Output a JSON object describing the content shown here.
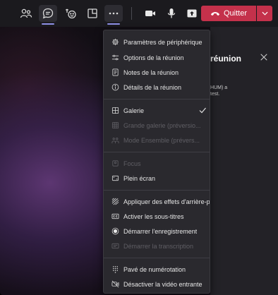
{
  "toolbar": {
    "quit_label": "Quitter",
    "icons": [
      "people-icon",
      "chat-icon",
      "reactions-icon",
      "rooms-icon",
      "more-icon",
      "camera-icon",
      "mic-icon",
      "share-icon",
      "phone-icon",
      "chevron-down-icon"
    ],
    "active": "chat-icon"
  },
  "side_panel": {
    "title": "réunion",
    "text_line1": "HUM) a",
    "text_line2": "test."
  },
  "menu": {
    "items": [
      {
        "label": "Paramètres de périphérique",
        "icon": "gear-icon",
        "disabled": false
      },
      {
        "label": "Options de la réunion",
        "icon": "sliders-icon",
        "disabled": false
      },
      {
        "label": "Notes de la réunion",
        "icon": "notes-icon",
        "disabled": false
      },
      {
        "label": "Détails de la réunion",
        "icon": "info-icon",
        "disabled": false
      },
      {
        "label": "Galerie",
        "icon": "gallery-icon",
        "disabled": false,
        "checked": true
      },
      {
        "label": "Grande galerie (préversio...",
        "icon": "large-gallery-icon",
        "disabled": true
      },
      {
        "label": "Mode Ensemble (prévers...",
        "icon": "together-mode-icon",
        "disabled": true
      },
      {
        "label": "Focus",
        "icon": "focus-icon",
        "disabled": true
      },
      {
        "label": "Plein écran",
        "icon": "fullscreen-icon",
        "disabled": false
      },
      {
        "label": "Appliquer des effets d'arrière-p",
        "icon": "background-effects-icon",
        "disabled": false
      },
      {
        "label": "Activer les sous-titres",
        "icon": "captions-icon",
        "disabled": false
      },
      {
        "label": "Démarrer l'enregistrement",
        "icon": "record-icon",
        "disabled": false
      },
      {
        "label": "Démarrer la transcription",
        "icon": "transcript-icon",
        "disabled": true
      },
      {
        "label": "Pavé de numérotation",
        "icon": "dialpad-icon",
        "disabled": false
      },
      {
        "label": "Désactiver la vidéo entrante",
        "icon": "video-off-icon",
        "disabled": false
      }
    ]
  }
}
